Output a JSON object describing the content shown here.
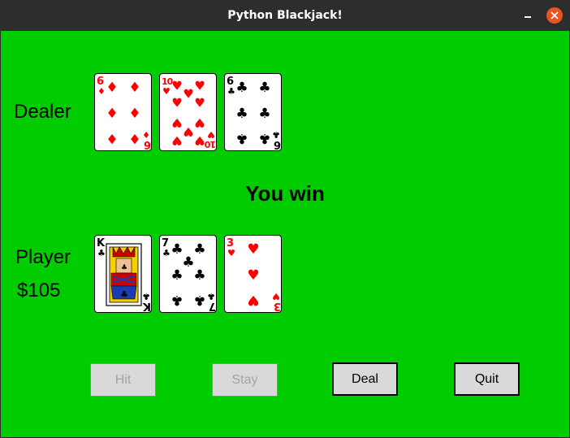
{
  "window": {
    "title": "Python Blackjack!",
    "colors": {
      "felt": "#00cc00",
      "titlebar": "#2d2d2d",
      "close": "#e95420"
    }
  },
  "dealer": {
    "label": "Dealer",
    "cards": [
      {
        "rank": "6",
        "suit": "diamonds",
        "color": "#ff0000"
      },
      {
        "rank": "10",
        "suit": "hearts",
        "color": "#ff0000"
      },
      {
        "rank": "6",
        "suit": "clubs",
        "color": "#000000"
      }
    ]
  },
  "result_text": "You win",
  "player": {
    "label": "Player",
    "money": "$105",
    "cards": [
      {
        "rank": "K",
        "suit": "clubs",
        "color": "#000000"
      },
      {
        "rank": "7",
        "suit": "clubs",
        "color": "#000000"
      },
      {
        "rank": "3",
        "suit": "hearts",
        "color": "#ff0000"
      }
    ]
  },
  "buttons": {
    "hit": "Hit",
    "stay": "Stay",
    "deal": "Deal",
    "quit": "Quit"
  }
}
